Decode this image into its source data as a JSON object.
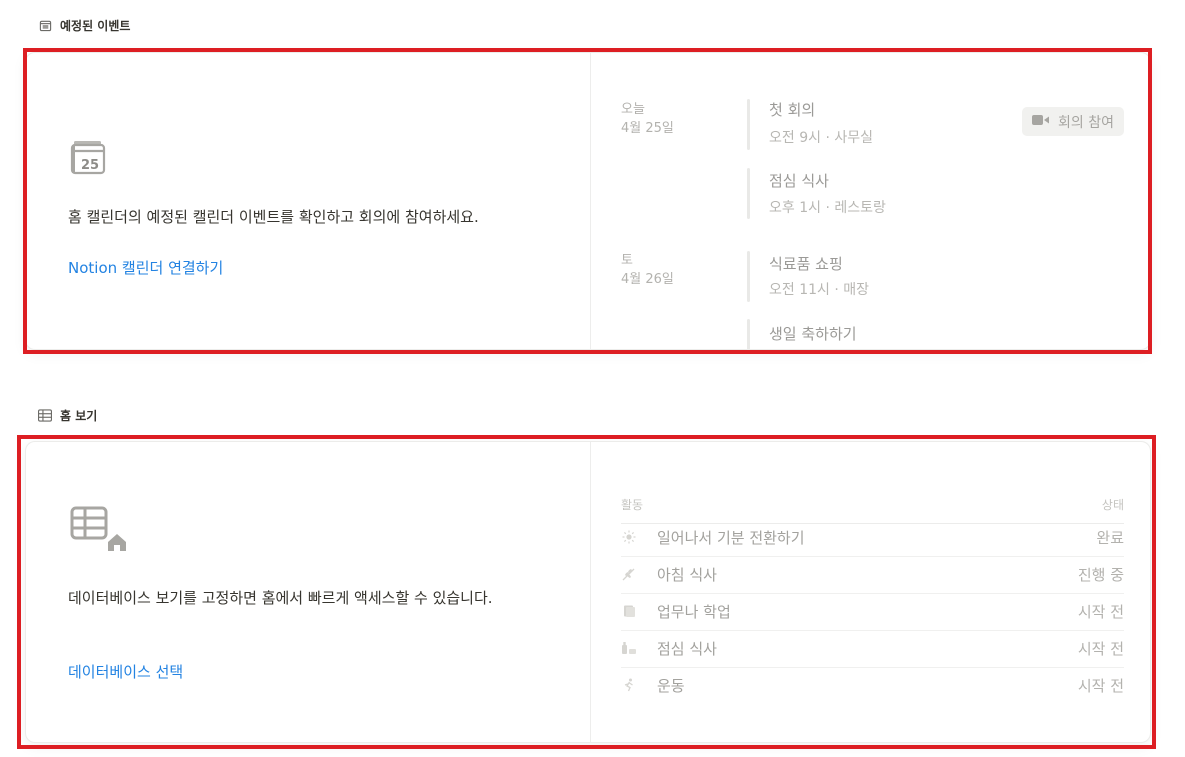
{
  "events_section": {
    "title": "예정된 이벤트",
    "icon": "calendar-icon",
    "calendar_day": "25",
    "description": "홈 캘린더의 예정된 캘린더 이벤트를 확인하고 회의에 참여하세요.",
    "connect_link": "Notion 캘린더 연결하기",
    "days": [
      {
        "label": "오늘",
        "date": "4월 25일"
      },
      {
        "label": "토",
        "date": "4월 26일"
      }
    ],
    "events": [
      {
        "title": "첫 회의",
        "detail": "오전 9시 · 사무실"
      },
      {
        "title": "점심 식사",
        "detail": "오후 1시 · 레스토랑"
      },
      {
        "title": "식료품 쇼핑",
        "detail": "오전 11시 · 매장"
      },
      {
        "title": "생일 축하하기",
        "detail": ""
      }
    ],
    "join_button": "회의 참여"
  },
  "views_section": {
    "title": "홈 보기",
    "icon": "table-icon",
    "description": "데이터베이스 보기를 고정하면 홈에서 빠르게 액세스할 수 있습니다.",
    "select_link": "데이터베이스 선택",
    "columns": {
      "activity": "활동",
      "status": "상태"
    },
    "rows": [
      {
        "icon": "sun-icon",
        "name": "일어나서 기분 전환하기",
        "status": "완료"
      },
      {
        "icon": "wheat-icon",
        "name": "아침 식사",
        "status": "진행 중"
      },
      {
        "icon": "book-icon",
        "name": "업무나 학업",
        "status": "시작 전"
      },
      {
        "icon": "meal-icon",
        "name": "점심 식사",
        "status": "시작 전"
      },
      {
        "icon": "running-icon",
        "name": "운동",
        "status": "시작 전"
      }
    ]
  },
  "colors": {
    "highlight": "#dd1e23",
    "link": "#2383e2"
  }
}
